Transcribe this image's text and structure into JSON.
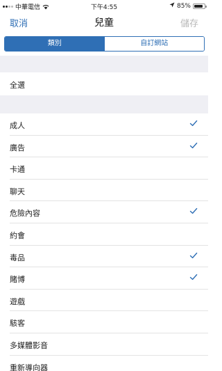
{
  "status_bar": {
    "carrier": "中華電信",
    "time": "下午4:55",
    "battery_percent": "85%",
    "battery_level": 0.85
  },
  "nav": {
    "cancel_label": "取消",
    "title": "兒童",
    "save_label": "儲存"
  },
  "segment": {
    "tabs": [
      {
        "label": "類別",
        "selected": true
      },
      {
        "label": "自訂網站",
        "selected": false
      }
    ]
  },
  "select_all_label": "全選",
  "categories": [
    {
      "label": "成人",
      "checked": true
    },
    {
      "label": "廣告",
      "checked": true
    },
    {
      "label": "卡通",
      "checked": false
    },
    {
      "label": "聊天",
      "checked": false
    },
    {
      "label": "危險內容",
      "checked": true
    },
    {
      "label": "約會",
      "checked": false
    },
    {
      "label": "毒品",
      "checked": true
    },
    {
      "label": "賭博",
      "checked": true
    },
    {
      "label": "遊戲",
      "checked": false
    },
    {
      "label": "駭客",
      "checked": false
    },
    {
      "label": "多媒體影音",
      "checked": false
    },
    {
      "label": "重新導向器",
      "checked": false
    }
  ],
  "colors": {
    "accent": "#2f6fb5",
    "disabled": "#b8b8b8",
    "group_bg": "#efeff4"
  },
  "icons": {
    "check": "checkmark-icon",
    "wifi": "wifi-icon",
    "location": "location-arrow-icon",
    "battery": "battery-icon"
  }
}
